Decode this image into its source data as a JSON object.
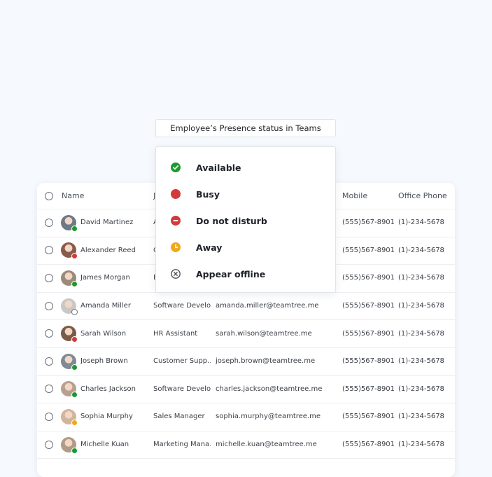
{
  "colors": {
    "available": "#1a9a2c",
    "busy": "#d33a3a",
    "dnd": "#d33a3a",
    "away": "#f0a81c",
    "offline": "#6b7079"
  },
  "legend": {
    "title": "Employee’s Presence status in Teams",
    "items": [
      {
        "label": "Available",
        "icon": "available-check-icon"
      },
      {
        "label": "Busy",
        "icon": "busy-dot-icon"
      },
      {
        "label": "Do not disturb",
        "icon": "do-not-disturb-icon"
      },
      {
        "label": "Away",
        "icon": "away-clock-icon"
      },
      {
        "label": "Appear offline",
        "icon": "offline-x-icon"
      }
    ]
  },
  "table": {
    "headers": {
      "name": "Name",
      "title": "J",
      "mobile": "Mobile",
      "phone": "Office Phone"
    },
    "rows": [
      {
        "name": "David Martinez",
        "title": "A",
        "email": "",
        "mobile": "(555)567-8901",
        "phone": "(1)-234-5678",
        "status": "available"
      },
      {
        "name": "Alexander Reed",
        "title": "C",
        "email": "",
        "mobile": "(555)567-8901",
        "phone": "(1)-234-5678",
        "status": "busy"
      },
      {
        "name": "James Morgan",
        "title": "E",
        "email": "",
        "mobile": "(555)567-8901",
        "phone": "(1)-234-5678",
        "status": "available"
      },
      {
        "name": "Amanda Miller",
        "title": "Software Develo...",
        "email": "amanda.miller@teamtree.me",
        "mobile": "(555)567-8901",
        "phone": "(1)-234-5678",
        "status": "offline"
      },
      {
        "name": "Sarah Wilson",
        "title": "HR Assistant",
        "email": "sarah.wilson@teamtree.me",
        "mobile": "(555)567-8901",
        "phone": "(1)-234-5678",
        "status": "busy"
      },
      {
        "name": "Joseph Brown",
        "title": "Customer Supp...",
        "email": "joseph.brown@teamtree.me",
        "mobile": "(555)567-8901",
        "phone": "(1)-234-5678",
        "status": "available"
      },
      {
        "name": "Charles Jackson",
        "title": "Software Develo...",
        "email": "charles.jackson@teamtree.me",
        "mobile": "(555)567-8901",
        "phone": "(1)-234-5678",
        "status": "available"
      },
      {
        "name": "Sophia Murphy",
        "title": "Sales Manager",
        "email": "sophia.murphy@teamtree.me",
        "mobile": "(555)567-8901",
        "phone": "(1)-234-5678",
        "status": "away"
      },
      {
        "name": "Michelle Kuan",
        "title": "Marketing Mana...",
        "email": "michelle.kuan@teamtree.me",
        "mobile": "(555)567-8901",
        "phone": "(1)-234-5678",
        "status": "available"
      }
    ]
  }
}
